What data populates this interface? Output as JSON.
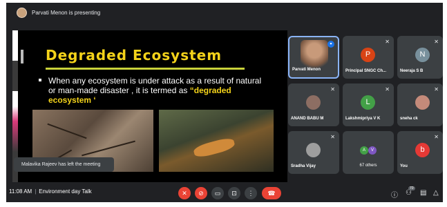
{
  "topbar": {
    "presenting_text": "Parvati Menon is presenting"
  },
  "slide": {
    "title": "Degraded Ecosystem",
    "bullet_prefix": "When any ecosystem is under attack as a result of natural or man-made disaster , it is termed as ",
    "bullet_highlight": "“degraded ecosystem ‘"
  },
  "toast": {
    "text": "Malavika Rajeev has left the meeting"
  },
  "participants": [
    {
      "name": "Parvati Menon",
      "type": "photo",
      "color": "#b08a6a",
      "speaking": true
    },
    {
      "name": "Principal SNGC Ch...",
      "type": "initial",
      "initial": "P",
      "color": "#d84315"
    },
    {
      "name": "Neeraja S B",
      "type": "initial",
      "initial": "N",
      "color": "#78909c"
    },
    {
      "name": "ANAND BABU M",
      "type": "photo",
      "color": "#8d6e63"
    },
    {
      "name": "Lakshmipriya V K",
      "type": "initial",
      "initial": "L",
      "color": "#43a047"
    },
    {
      "name": "sneha ck",
      "type": "photo",
      "color": "#c48a7a"
    },
    {
      "name": "Sradha Vijay",
      "type": "photo",
      "color": "#9e9e9e"
    },
    {
      "name": "67 others",
      "type": "group",
      "initials": [
        "A",
        "V"
      ],
      "colors": [
        "#43a047",
        "#7e57c2"
      ]
    },
    {
      "name": "You",
      "type": "initial",
      "initial": "b",
      "color": "#e53935"
    }
  ],
  "bottom": {
    "time": "11:08 AM",
    "meeting_title": "Environment day Talk",
    "participant_count": "70"
  }
}
